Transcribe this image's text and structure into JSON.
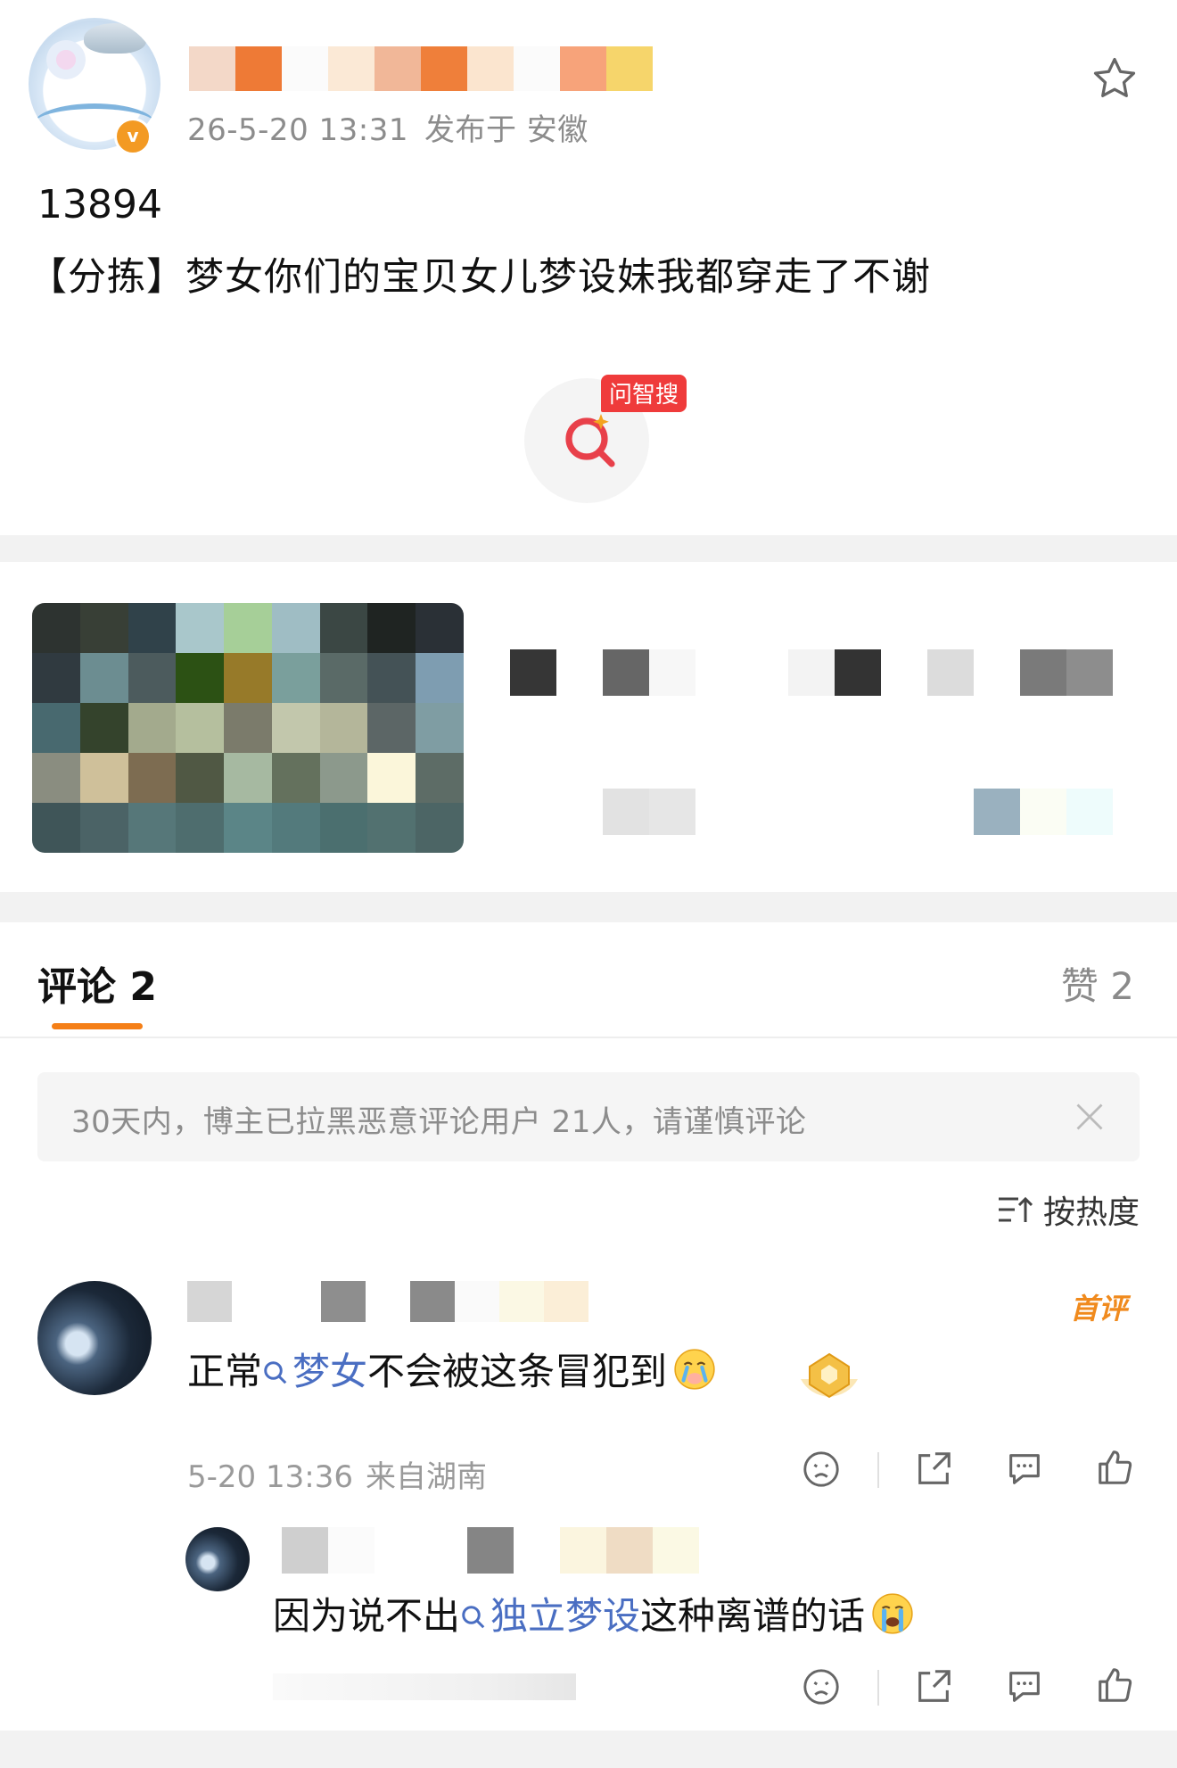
{
  "post": {
    "author_name": "",
    "time": "26-5-20 13:31",
    "location": "发布于 安徽",
    "number": "13894",
    "text": "【分拣】梦女你们的宝贝女儿梦设妹我都穿走了不谢",
    "ai_search_label": "问智搜",
    "verified_mark": "v"
  },
  "tabs": {
    "comments_label": "评论 2",
    "likes_label": "赞 2"
  },
  "notice": {
    "text": "30天内，博主已拉黑恶意评论用户 21人，请谨慎评论"
  },
  "sort": {
    "label": "按热度"
  },
  "comments": [
    {
      "text_before": "正常",
      "keyword": "梦女",
      "text_after": "不会被这条冒犯到",
      "first_badge": "首评",
      "time": "5-20 13:36",
      "location": "来自湖南",
      "emoji": "crying-face"
    },
    {
      "text_before": "因为说不出",
      "keyword": "独立梦设",
      "text_after": "这种离谱的话",
      "emoji": "sobbing-face"
    }
  ],
  "colors": {
    "accent": "#f57f17",
    "keyword": "#4a6ec2",
    "ai_tag": "#ef3b3b",
    "verified": "#f39a23"
  }
}
